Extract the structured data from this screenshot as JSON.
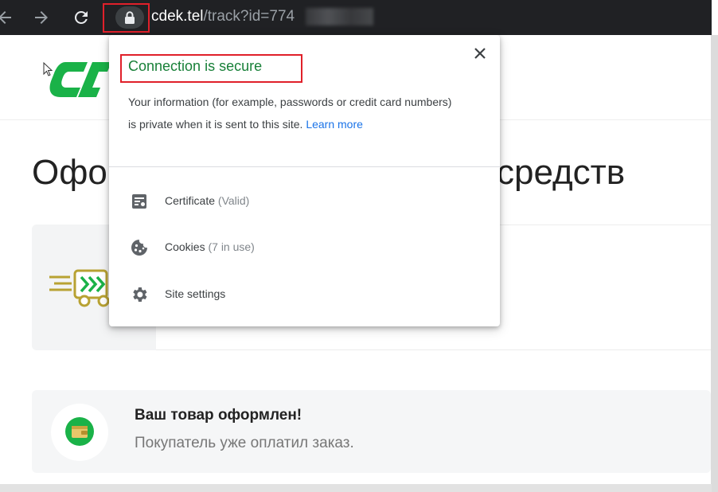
{
  "browser": {
    "url_host": "cdek.tel",
    "url_path": "/track?id=774"
  },
  "page": {
    "heading_left": "Офо",
    "heading_right": "средств",
    "order_card": {
      "title": "Ваш товар оформлен!",
      "subtitle": "Покупатель уже оплатил заказ."
    }
  },
  "popup": {
    "title": "Connection is secure",
    "description": "Your information (for example, passwords or credit card numbers) is private when it is sent to this site.",
    "learn_more": "Learn more",
    "items": [
      {
        "label": "Certificate",
        "detail": "(Valid)",
        "icon": "certificate-icon"
      },
      {
        "label": "Cookies",
        "detail": "(7 in use)",
        "icon": "cookie-icon"
      },
      {
        "label": "Site settings",
        "detail": "",
        "icon": "gear-icon"
      }
    ]
  },
  "colors": {
    "chrome_bg": "#202124",
    "secure_green": "#188038",
    "link_blue": "#1a73e8",
    "annotation_red": "#e0202a",
    "brand_green": "#1ab248"
  }
}
